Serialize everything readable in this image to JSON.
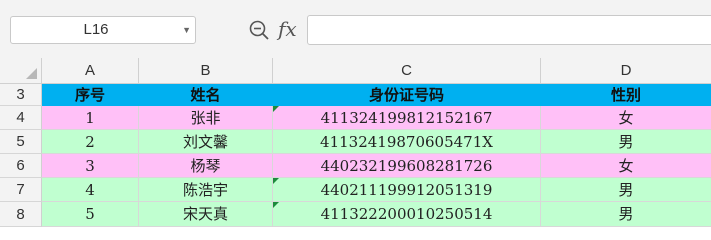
{
  "formula_bar": {
    "name_box": "L16",
    "fx_label": "fx",
    "formula_value": ""
  },
  "columns": [
    "A",
    "B",
    "C",
    "D"
  ],
  "rows": [
    {
      "row": "3",
      "cells": [
        "序号",
        "姓名",
        "身份证号码",
        "性别"
      ]
    },
    {
      "row": "4",
      "cells": [
        "1",
        "张非",
        "411324199812152167",
        "女"
      ]
    },
    {
      "row": "5",
      "cells": [
        "2",
        "刘文馨",
        "41132419870605471X",
        "男"
      ]
    },
    {
      "row": "6",
      "cells": [
        "3",
        "杨琴",
        "440232199608281726",
        "女"
      ]
    },
    {
      "row": "7",
      "cells": [
        "4",
        "陈浩宇",
        "440211199912051319",
        "男"
      ]
    },
    {
      "row": "8",
      "cells": [
        "5",
        "宋天真",
        "411322200010250514",
        "男"
      ]
    }
  ],
  "colors": {
    "header_fill": "#00b0f0",
    "female_fill": "#ffc0f7",
    "male_fill": "#c0ffd0",
    "text_as_number_marker": "#1d8a3c"
  }
}
